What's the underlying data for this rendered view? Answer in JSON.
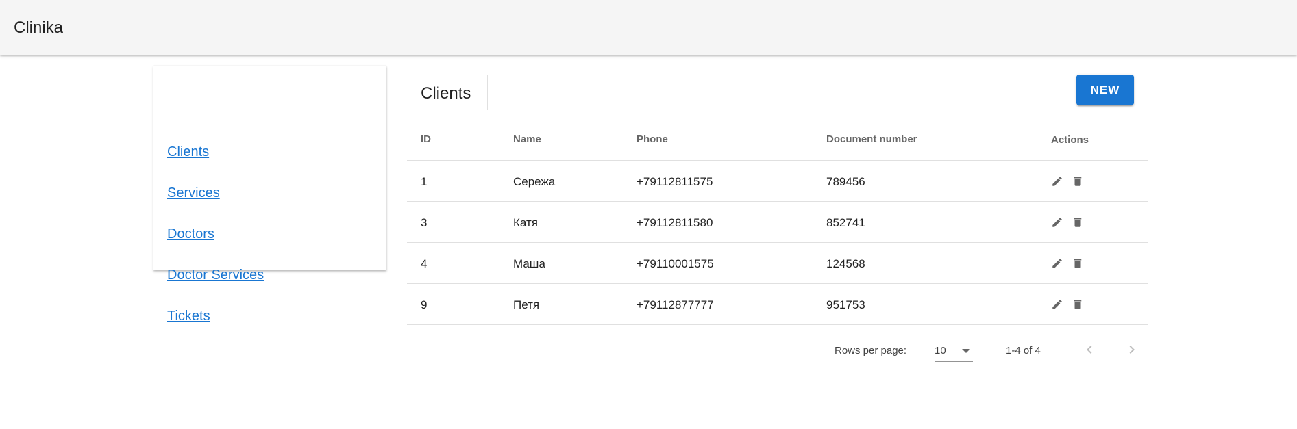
{
  "app": {
    "title": "Clinika"
  },
  "sidebar": {
    "items": [
      {
        "label": "Clients"
      },
      {
        "label": "Services"
      },
      {
        "label": "Doctors"
      },
      {
        "label": "Doctor Services"
      },
      {
        "label": "Tickets"
      }
    ]
  },
  "main": {
    "title": "Clients",
    "new_button_label": "NEW"
  },
  "table": {
    "headers": {
      "id": "ID",
      "name": "Name",
      "phone": "Phone",
      "document": "Document number",
      "actions": "Actions"
    },
    "rows": [
      {
        "id": "1",
        "name": "Сережа",
        "phone": "+79112811575",
        "document": "789456"
      },
      {
        "id": "3",
        "name": "Катя",
        "phone": "+79112811580",
        "document": "852741"
      },
      {
        "id": "4",
        "name": "Маша",
        "phone": "+79110001575",
        "document": "124568"
      },
      {
        "id": "9",
        "name": "Петя",
        "phone": "+79112877777",
        "document": "951753"
      }
    ],
    "row_action_icons": [
      "edit-icon",
      "delete-icon"
    ]
  },
  "pagination": {
    "rows_per_page_label": "Rows per page:",
    "rows_per_page_value": "10",
    "range_label": "1-4 of 4"
  },
  "colors": {
    "primary": "#1976d2",
    "appbar": "#f5f5f5",
    "link": "#1976d2"
  }
}
